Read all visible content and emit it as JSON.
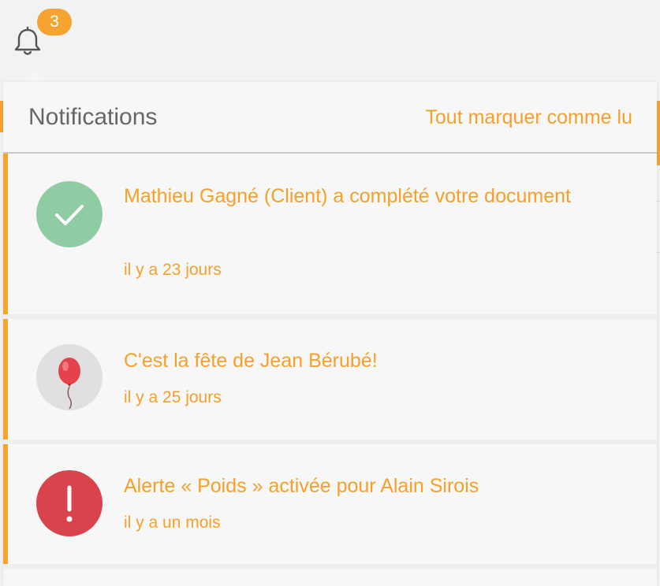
{
  "header": {
    "badge_count": "3",
    "icon": "bell-icon"
  },
  "dropdown": {
    "title": "Notifications",
    "mark_all_label": "Tout marquer comme lu"
  },
  "notifications": [
    {
      "message": "Mathieu Gagné (Client) a complété votre document",
      "time": "il y a 23 jours",
      "icon": "check-icon",
      "icon_color": "#8fcca3"
    },
    {
      "message": "C'est la fête de Jean Bérubé!",
      "time": "il y a 25 jours",
      "icon": "balloon-icon",
      "icon_color": "#e0e0e0"
    },
    {
      "message": "Alerte « Poids » activée pour Alain Sirois",
      "time": "il y a un mois",
      "icon": "exclamation-icon",
      "icon_color": "#d9434b"
    }
  ],
  "colors": {
    "accent": "#f6a330"
  }
}
